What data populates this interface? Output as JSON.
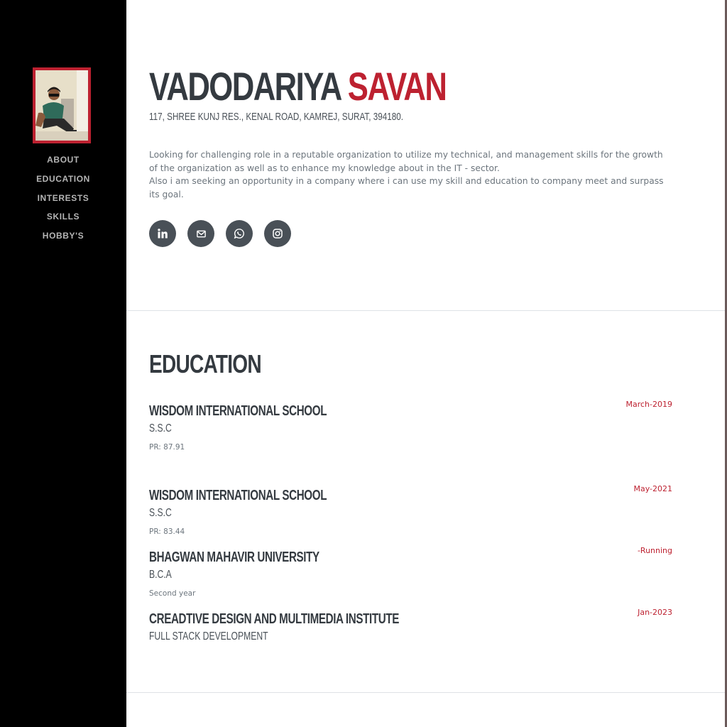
{
  "colors": {
    "accent": "#bd2130",
    "sidebar_bg": "#000000",
    "heading": "#343a40",
    "text": "#6c757d"
  },
  "sidebar": {
    "nav": [
      "About",
      "Education",
      "Interests",
      "Skills",
      "Hobby's"
    ]
  },
  "profile": {
    "first_name": "VADODARIYA",
    "last_name": "SAVAN",
    "address": "117, Shree Kunj Res., Kenal Road, Kamrej, Surat, 394180.",
    "about_line1": "Looking for challenging role in a reputable organization to utilize my technical, and management skills for the growth of the organization as well as to enhance my knowledge about in the IT - sector.",
    "about_line2": "Also i am seeking an opportunity in a company where i can use my skill and education to company meet and surpass its goal.",
    "socials": [
      "linkedin-icon",
      "mail-icon",
      "whatsapp-icon",
      "instagram-icon"
    ]
  },
  "education": {
    "title": "Education",
    "items": [
      {
        "school": "Wisdom International School",
        "degree": "S.S.C",
        "note": "PR: 87.91",
        "date": "March-2019"
      },
      {
        "school": "Wisdom International School",
        "degree": "S.S.C",
        "note": "PR: 83.44",
        "date": "May-2021"
      },
      {
        "school": "Bhagwan Mahavir University",
        "degree": "B.C.A",
        "note": "Second year",
        "date": "-Running"
      },
      {
        "school": "Creadtive Design and Multimedia Institute",
        "degree": "Full Stack Development",
        "note": "",
        "date": "Jan-2023"
      }
    ]
  }
}
